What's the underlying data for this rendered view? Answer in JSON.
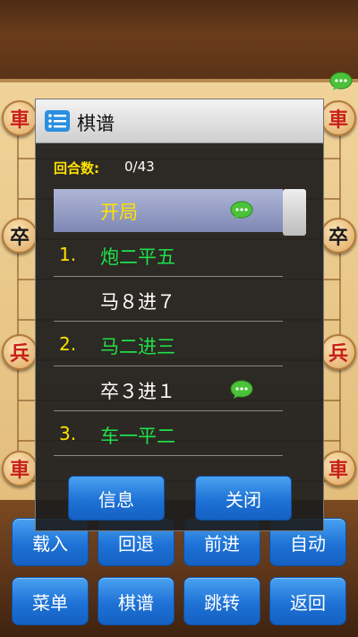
{
  "board": {
    "pieces": {
      "left_top": "車",
      "right_top": "車",
      "left_mid": "卒",
      "right_mid": "卒",
      "left_red": "兵",
      "right_red": "兵",
      "left_bottom": "車",
      "right_bottom": "車"
    }
  },
  "dialog": {
    "title": "棋谱",
    "round_label": "回合数:",
    "round_value": "0/43",
    "moves": [
      {
        "num": "",
        "move": "开局",
        "style": "yellow",
        "selected": true,
        "comment": true
      },
      {
        "num": "1.",
        "move": "炮二平五",
        "style": "green",
        "selected": false,
        "comment": false
      },
      {
        "num": "",
        "move": "马８进７",
        "style": "white",
        "selected": false,
        "comment": false
      },
      {
        "num": "2.",
        "move": "马二进三",
        "style": "green",
        "selected": false,
        "comment": false
      },
      {
        "num": "",
        "move": "卒３进１",
        "style": "white",
        "selected": false,
        "comment": true
      },
      {
        "num": "3.",
        "move": "车一平二",
        "style": "green",
        "selected": false,
        "comment": false
      }
    ],
    "info_button": "信息",
    "close_button": "关闭"
  },
  "toolbar": {
    "row1": [
      "载入",
      "回退",
      "前进",
      "自动"
    ],
    "row2": [
      "菜单",
      "棋谱",
      "跳转",
      "返回"
    ]
  },
  "colors": {
    "accent_blue": "#1e72d6",
    "move_green": "#1fe04a",
    "number_yellow": "#ffe200"
  }
}
